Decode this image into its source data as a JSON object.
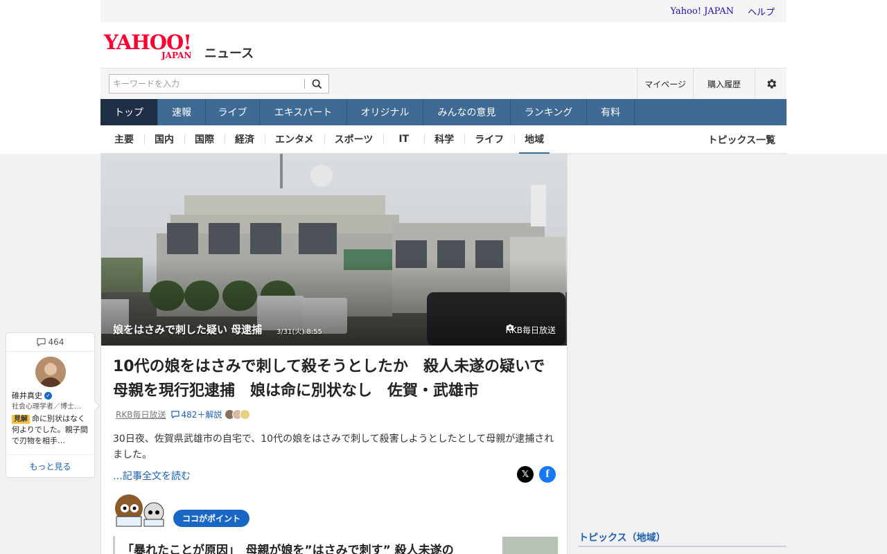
{
  "util": {
    "links": [
      "Yahoo! JAPAN",
      "ヘルプ"
    ]
  },
  "brand": {
    "logo_main": "YAHOO!",
    "logo_sub": "JAPAN",
    "service": "ニュース"
  },
  "search": {
    "placeholder": "キーワードを入力"
  },
  "user_buttons": {
    "mypage": "マイページ",
    "history": "購入履歴"
  },
  "main_nav": [
    "トップ",
    "速報",
    "ライブ",
    "エキスパート",
    "オリジナル",
    "みんなの意見",
    "ランキング",
    "有料"
  ],
  "sub_nav": [
    "主要",
    "国内",
    "国際",
    "経済",
    "エンタメ",
    "スポーツ",
    "IT",
    "科学",
    "ライフ",
    "地域"
  ],
  "topics_all": "トピックス一覧",
  "hero": {
    "caption": "娘をはさみで刺した疑い 母逮捕",
    "date": "3/31(火) 8:55",
    "credit": "RKB毎日放送"
  },
  "article": {
    "title": "10代の娘をはさみで刺して殺そうとしたか　殺人未遂の疑いで母親を現行犯逮捕　娘は命に別状なし　佐賀・武雄市",
    "source": "RKB毎日放送",
    "comments": "482＋解説",
    "lead": "30日夜、佐賀県武雄市の自宅で、10代の娘をはさみで刺して殺害しようとしたとして母親が逮捕されました。",
    "read_more": "…記事全文を読む"
  },
  "point": {
    "badge": "ココがポイント",
    "headline": "「暴れたことが原因」　母親が娘を”はさみで刺す” 殺人未遂の"
  },
  "expert": {
    "count": "464",
    "name": "碓井真史",
    "role": "社会心理学者／博士…",
    "tag": "見解",
    "comment": "命に別状はなく何よりでした。親子間で刃物を相手…",
    "more": "もっと見る"
  },
  "topics_regional": "トピックス（地域）",
  "colors": {
    "nav_bg": "#3e6a94",
    "nav_active": "#1e2e44",
    "brand_red": "#ff0033",
    "link_blue": "#1a5fb4"
  }
}
